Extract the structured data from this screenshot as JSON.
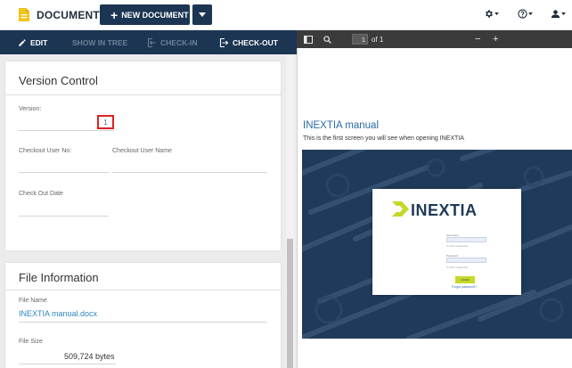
{
  "app": {
    "title": "DOCUMENT",
    "new_document_label": "NEW DOCUMENT",
    "icons": [
      "document-icon",
      "plus-icon",
      "caret-down-icon",
      "gear-icon",
      "help-icon",
      "user-icon"
    ]
  },
  "toolbar": {
    "edit_label": "EDIT",
    "show_in_tree_label": "SHOW IN TREE",
    "check_in_label": "CHECK-IN",
    "check_out_label": "CHECK-OUT"
  },
  "version_control": {
    "title": "Version Control",
    "version_label": "Version:",
    "version_value": "1",
    "checkout_user_no_label": "Checkout User No:",
    "checkout_user_name_label": "Checkout User Name",
    "check_out_date_label": "Check Out Date"
  },
  "file_information": {
    "title": "File Information",
    "file_name_label": "File Name",
    "file_name_value": "INEXTIA manual.docx",
    "file_size_label": "File Size",
    "file_size_value": "509,724",
    "file_size_unit": "bytes"
  },
  "viewer": {
    "current_page": "1",
    "page_total": "of 1",
    "zoom_out": "−",
    "zoom_in": "+",
    "manual_title": "INEXTIA manual",
    "manual_subtitle": "This is the first screen you will see when opening INEXTIA",
    "brand": "INEXTIA",
    "login_username_label": "Username",
    "login_password_label": "Password",
    "login_remember_label": "Confirm password",
    "login_button_label": "LOGIN",
    "forgot_password_label": "Forgot password?"
  },
  "colors": {
    "primary_navy": "#1c3553",
    "viewer_toolbar": "#3b3b3b",
    "link_blue": "#2e86c1",
    "highlight_red": "#e02020",
    "brand_lime": "#c4d92a"
  }
}
